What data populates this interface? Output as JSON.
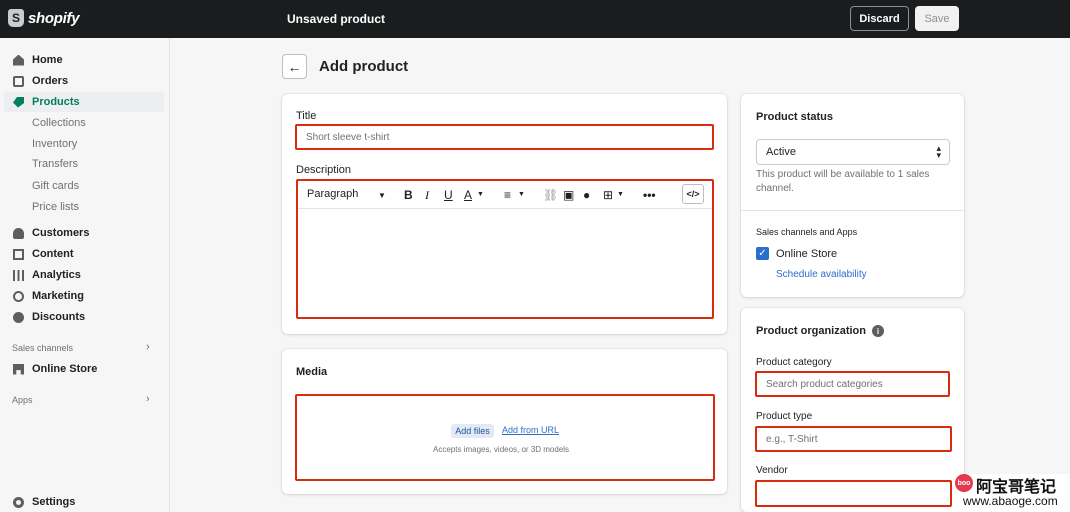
{
  "topbar": {
    "logo_text": "shopify",
    "status": "Unsaved product",
    "discard_label": "Discard",
    "save_label": "Save"
  },
  "sidebar": {
    "items": [
      {
        "label": "Home",
        "icon": "home-icon"
      },
      {
        "label": "Orders",
        "icon": "orders-icon"
      },
      {
        "label": "Products",
        "icon": "tag-icon"
      },
      {
        "label": "Customers",
        "icon": "person-icon"
      },
      {
        "label": "Content",
        "icon": "content-icon"
      },
      {
        "label": "Analytics",
        "icon": "analytics-icon"
      },
      {
        "label": "Marketing",
        "icon": "marketing-icon"
      },
      {
        "label": "Discounts",
        "icon": "discount-icon"
      }
    ],
    "product_subitems": [
      "Collections",
      "Inventory",
      "Transfers",
      "Gift cards",
      "Price lists"
    ],
    "sales_channels_label": "Sales channels",
    "online_store_label": "Online Store",
    "apps_label": "Apps",
    "settings_label": "Settings"
  },
  "page": {
    "title": "Add product"
  },
  "main_card": {
    "title_label": "Title",
    "title_value": "Short sleeve t-shirt",
    "description_label": "Description",
    "paragraph_label": "Paragraph"
  },
  "media": {
    "title": "Media",
    "add_files": "Add files",
    "add_from_url": "Add from URL",
    "hint": "Accepts images, videos, or 3D models"
  },
  "status_card": {
    "title": "Product status",
    "value": "Active",
    "help": "This product will be available to 1 sales channel.",
    "channels_label": "Sales channels and Apps",
    "online_store": "Online Store",
    "schedule": "Schedule availability"
  },
  "organization": {
    "title": "Product organization",
    "category_label": "Product category",
    "category_placeholder": "Search product categories",
    "type_label": "Product type",
    "type_placeholder": "e.g., T-Shirt",
    "vendor_label": "Vendor"
  },
  "watermark": {
    "badge": "boo",
    "title": "阿宝哥笔记",
    "url": "www.abaoge.com"
  },
  "colors": {
    "accent": "#008060",
    "highlight": "#d72c0d",
    "link": "#2c6ecb"
  }
}
